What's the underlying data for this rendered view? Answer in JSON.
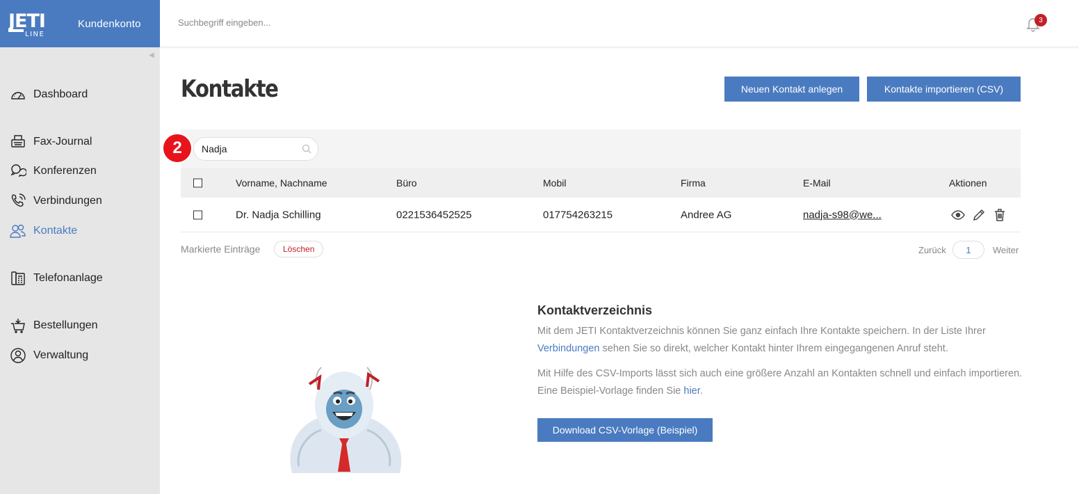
{
  "brand": {
    "logo_text": "JETI LINE",
    "subtitle": "Kundenkonto"
  },
  "colors": {
    "accent": "#4a7bc0",
    "sidebar_bg": "#e6e6e6",
    "badge_red": "#c0202a",
    "step_badge": "#e8141c"
  },
  "sidebar": {
    "items": [
      {
        "label": "Dashboard",
        "icon": "speedometer-icon",
        "active": false
      },
      {
        "label": "Fax-Journal",
        "icon": "fax-icon",
        "active": false
      },
      {
        "label": "Konferenzen",
        "icon": "chat-bubbles-icon",
        "active": false
      },
      {
        "label": "Verbindungen",
        "icon": "phone-ringing-icon",
        "active": false
      },
      {
        "label": "Kontakte",
        "icon": "contacts-icon",
        "active": true
      },
      {
        "label": "Telefonanlage",
        "icon": "phone-system-icon",
        "active": false
      },
      {
        "label": "Bestellungen",
        "icon": "cart-icon",
        "active": false
      },
      {
        "label": "Verwaltung",
        "icon": "user-circle-icon",
        "active": false
      }
    ]
  },
  "header": {
    "search_placeholder": "Suchbegriff eingeben...",
    "notification_count": "3"
  },
  "main": {
    "title": "Kontakte",
    "new_contact_label": "Neuen Kontakt anlegen",
    "import_label": "Kontakte importieren (CSV)",
    "step_marker": "2",
    "filter_value": "Nadja"
  },
  "table": {
    "columns": [
      "Vorname, Nachname",
      "Büro",
      "Mobil",
      "Firma",
      "E-Mail",
      "Aktionen"
    ],
    "rows": [
      {
        "name": "Dr. Nadja Schilling",
        "office": "0221536452525",
        "mobile": "017754263215",
        "company": "Andree AG",
        "email": "nadja-s98@we..."
      }
    ]
  },
  "footer": {
    "marked_label": "Markierte Einträge",
    "delete_label": "Löschen",
    "back_label": "Zurück",
    "page": "1",
    "next_label": "Weiter"
  },
  "info": {
    "title": "Kontaktverzeichnis",
    "p1_before": "Mit dem JETI Kontaktverzeichnis können Sie ganz einfach Ihre Kontakte speichern. In der Liste Ihrer",
    "p1_link": "Verbindungen",
    "p1_after": " sehen Sie so direkt, welcher Kontakt hinter Ihrem eingegangenen Anruf steht.",
    "p2_before": "Mit Hilfe des CSV-Imports lässt sich auch eine größere Anzahl an Kontakten schnell und einfach importieren. Eine Beispiel-Vorlage finden Sie ",
    "p2_link": "hier",
    "p2_after": ".",
    "download_label": "Download CSV-Vorlage (Beispiel)"
  }
}
